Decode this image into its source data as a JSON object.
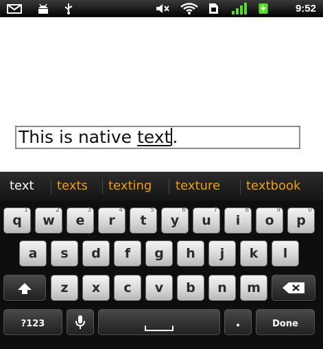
{
  "status_bar": {
    "time": "9:52",
    "icons": [
      "gmail-icon",
      "android-debug-icon",
      "usb-icon",
      "mute-icon",
      "wifi-icon",
      "sim-icon",
      "signal-icon",
      "battery-charging-icon"
    ]
  },
  "editor": {
    "text_before": "This is native ",
    "composing_text": "text",
    "text_after": "."
  },
  "suggestions": [
    "text",
    "texts",
    "texting",
    "texture",
    "textbook"
  ],
  "keyboard": {
    "row1": [
      {
        "label": "q",
        "alt": "1"
      },
      {
        "label": "w",
        "alt": "2"
      },
      {
        "label": "e",
        "alt": "3"
      },
      {
        "label": "r",
        "alt": "4"
      },
      {
        "label": "t",
        "alt": "5"
      },
      {
        "label": "y",
        "alt": "6"
      },
      {
        "label": "u",
        "alt": "7"
      },
      {
        "label": "i",
        "alt": "8"
      },
      {
        "label": "o",
        "alt": "9"
      },
      {
        "label": "p",
        "alt": "0"
      }
    ],
    "row2": [
      "a",
      "s",
      "d",
      "f",
      "g",
      "h",
      "j",
      "k",
      "l"
    ],
    "row3": [
      "z",
      "x",
      "c",
      "v",
      "b",
      "n",
      "m"
    ],
    "symbols_label": "?123",
    "period_label": ".",
    "done_label": "Done",
    "accent_colors": {
      "suggestion": "#f0a000",
      "primary_suggestion": "#ffffff"
    }
  }
}
